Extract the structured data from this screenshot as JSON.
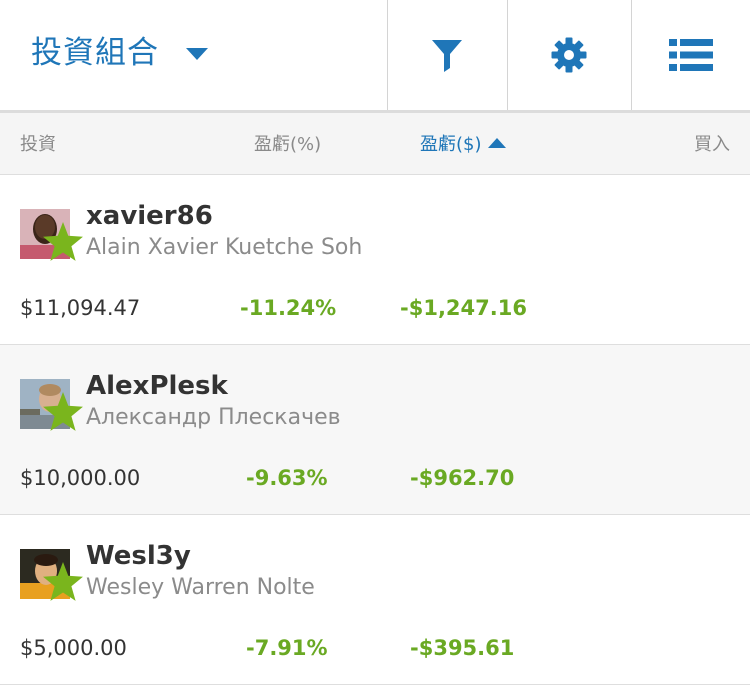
{
  "header": {
    "title": "投資組合"
  },
  "columns": {
    "invest": "投資",
    "pl_percent": "盈虧(%)",
    "pl_dollar": "盈虧($)",
    "buy": "買入"
  },
  "colors": {
    "accent": "#1f76b8",
    "gain_loss": "#6aa923",
    "star": "#7ab51d"
  },
  "icons": [
    "caret-down-icon",
    "filter-icon",
    "gear-icon",
    "list-icon",
    "star-icon",
    "sort-up-icon"
  ],
  "rows": [
    {
      "username": "xavier86",
      "full_name": "Alain Xavier Kuetche Soh",
      "amount": "$11,094.47",
      "pl_percent": "-11.24%",
      "pl_dollar": "-$1,247.16"
    },
    {
      "username": "AlexPlesk",
      "full_name": "Александр Плескачев",
      "amount": "$10,000.00",
      "pl_percent": "-9.63%",
      "pl_dollar": "-$962.70"
    },
    {
      "username": "Wesl3y",
      "full_name": "Wesley Warren Nolte",
      "amount": "$5,000.00",
      "pl_percent": "-7.91%",
      "pl_dollar": "-$395.61"
    }
  ]
}
